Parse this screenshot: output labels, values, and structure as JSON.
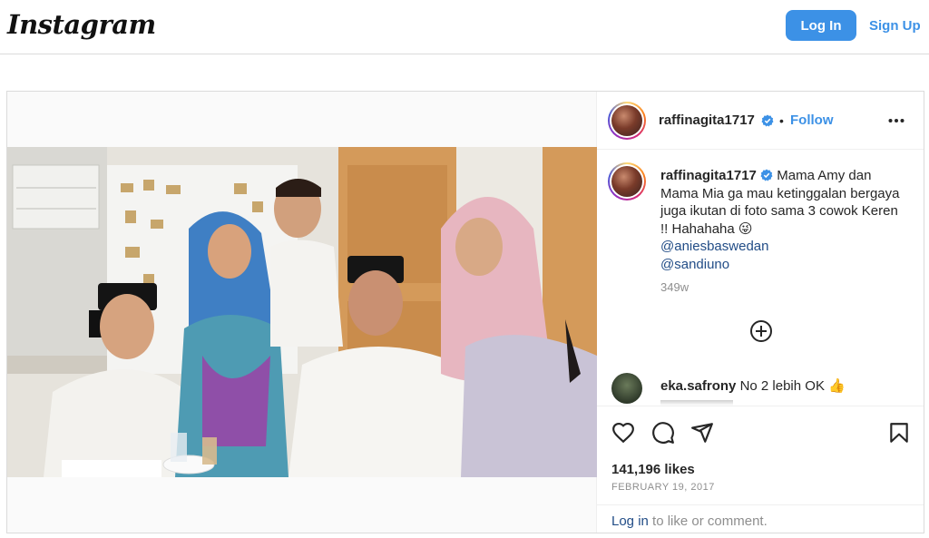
{
  "header": {
    "logo_text": "Instagram",
    "login_label": "Log In",
    "signup_label": "Sign Up"
  },
  "post": {
    "username": "raffinagita1717",
    "follow_label": "Follow",
    "separator": "•",
    "caption_text": "Mama Amy dan Mama Mia ga mau ketinggalan bergaya juga ikutan di foto sama 3 cowok Keren !! Hahahaha 😜",
    "mentions": [
      "@aniesbaswedan",
      "@sandiuno"
    ],
    "caption_time": "349w",
    "comment": {
      "username": "eka.safrony",
      "text": "No 2 lebih OK 👍"
    },
    "likes": "141,196 likes",
    "date": "FEBRUARY 19, 2017",
    "login_prompt_link": "Log in",
    "login_prompt_rest": " to like or comment."
  },
  "colors": {
    "accent": "#3c91e6",
    "mention": "#224d87",
    "secondary_text": "#8e8e8e",
    "border": "#dbdbdb"
  },
  "icons": [
    "verified-icon",
    "more-options-icon",
    "load-more-comments-icon",
    "heart-icon",
    "comment-icon",
    "share-icon",
    "bookmark-icon",
    "user-tag-icon"
  ]
}
